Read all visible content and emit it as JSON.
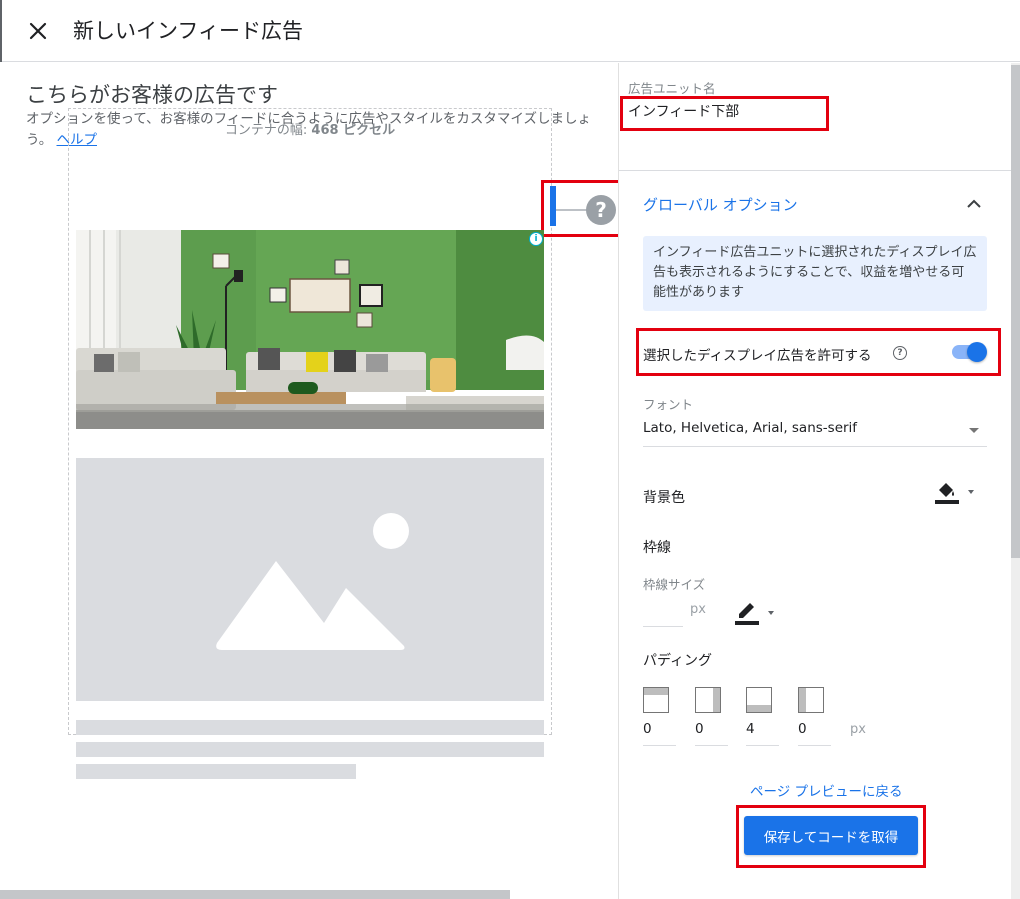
{
  "dialog": {
    "title": "新しいインフィード広告",
    "close_icon": "close-icon"
  },
  "preview": {
    "heading": "こちらがお客様の広告です",
    "description": "オプションを使って、お客様のフィードに合うように広告やスタイルをカスタマイズしましょう。",
    "help_link": "ヘルプ",
    "container_width_label": "コンテナの幅: ",
    "container_width_value": "468 ピクセル",
    "help_icon": "?",
    "adchoices_icon": "i"
  },
  "settings": {
    "unit_name_label": "広告ユニット名",
    "unit_name_value": "インフィード下部",
    "global_options_title": "グローバル オプション",
    "info_text": "インフィード広告ユニットに選択されたディスプレイ広告も表示されるようにすることで、収益を増やせる可能性があります",
    "allow_display_ads_label": "選択したディスプレイ広告を許可する",
    "allow_display_ads_enabled": true,
    "font_label": "フォント",
    "font_value": "Lato, Helvetica, Arial, sans-serif",
    "background_color_label": "背景色",
    "border_label": "枠線",
    "border_size_label": "枠線サイズ",
    "border_size_unit": "px",
    "border_size_value": "",
    "padding_label": "パディング",
    "padding_values": [
      "0",
      "0",
      "4",
      "0"
    ],
    "padding_unit": "px"
  },
  "footer": {
    "back_link": "ページ プレビューに戻る",
    "save_button": "保存してコードを取得"
  },
  "colors": {
    "accent": "#1a73e8",
    "highlight_box": "#e3000f",
    "info_bg": "#e8f0fe"
  }
}
